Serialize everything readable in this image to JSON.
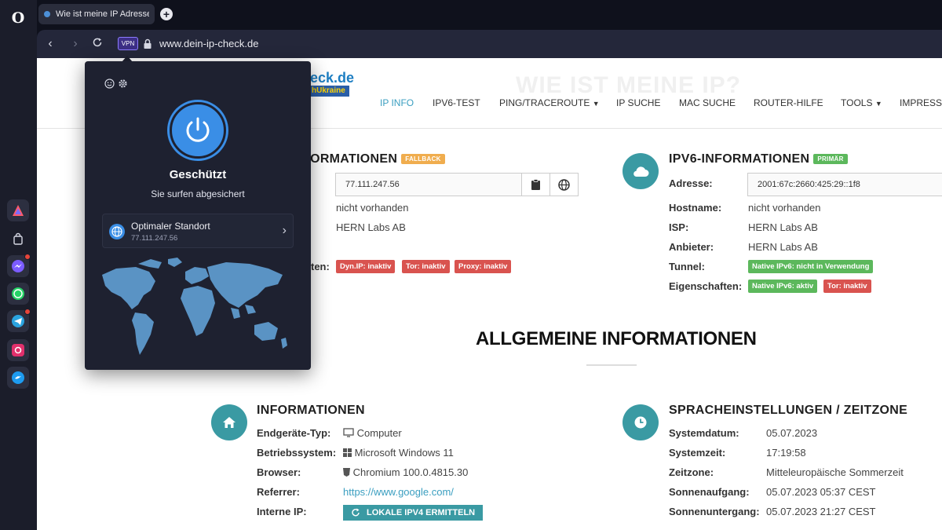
{
  "browser": {
    "tab_title": "Wie ist meine IP Adresse ü",
    "url": "www.dein-ip-check.de",
    "vpn_label": "VPN"
  },
  "site": {
    "logo_fragment": "eck.de",
    "logo_fragment2": "hUkraine",
    "watermark": "WIE IST MEINE IP?",
    "menu": [
      "IP INFO",
      "IPV6-TEST",
      "PING/TRACEROUTE",
      "IP SUCHE",
      "MAC SUCHE",
      "ROUTER-HILFE",
      "TOOLS",
      "IMPRESSU"
    ]
  },
  "ipv4": {
    "title_fragment": "FORMATIONEN",
    "badge": "FALLBACK",
    "address": "77.111.247.56",
    "hostname": "nicht vorhanden",
    "isp": "HERN Labs AB",
    "label_fragment": "ten:",
    "tags": [
      "Dyn.IP: inaktiv",
      "Tor: inaktiv",
      "Proxy: inaktiv"
    ]
  },
  "ipv6": {
    "title": "IPV6-INFORMATIONEN",
    "badge": "PRIMÄR",
    "labels": [
      "Adresse:",
      "Hostname:",
      "ISP:",
      "Anbieter:",
      "Tunnel:",
      "Eigenschaften:"
    ],
    "address": "2001:67c:2660:425:29::1f8",
    "hostname": "nicht vorhanden",
    "isp": "HERN Labs AB",
    "provider": "HERN Labs AB",
    "tunnel_tag": "Native IPv6: nicht in Verwendung",
    "prop_tags": [
      "Native IPv6: aktiv",
      "Tor: inaktiv"
    ]
  },
  "general": {
    "title": "ALLGEMEINE INFORMATIONEN"
  },
  "info": {
    "title": "INFORMATIONEN",
    "labels": [
      "Endgeräte-Typ:",
      "Betriebssystem:",
      "Browser:",
      "Referrer:",
      "Interne IP:"
    ],
    "device": "Computer",
    "os": "Microsoft Windows 11",
    "browser": "Chromium 100.0.4815.30",
    "referrer": "https://www.google.com/",
    "button": "LOKALE IPV4 ERMITTELN"
  },
  "lang": {
    "title": "SPRACHEINSTELLUNGEN / ZEITZONE",
    "labels": [
      "Systemdatum:",
      "Systemzeit:",
      "Zeitzone:",
      "Sonnenaufgang:",
      "Sonnenuntergang:"
    ],
    "values": [
      "05.07.2023",
      "17:19:58",
      "Mitteleuropäische Sommerzeit",
      "05.07.2023 05:37 CEST",
      "05.07.2023 21:27 CEST"
    ]
  },
  "vpn_popup": {
    "status": "Geschützt",
    "subtitle": "Sie surfen abgesichert",
    "location_name": "Optimaler Standort",
    "location_ip": "77.111.247.56"
  },
  "colors": {
    "accent": "#3a9aa3",
    "link": "#3a9ec0",
    "tag_red": "#d9534f",
    "tag_green": "#5cb85c",
    "vpn_blue": "#3a8ee6"
  }
}
